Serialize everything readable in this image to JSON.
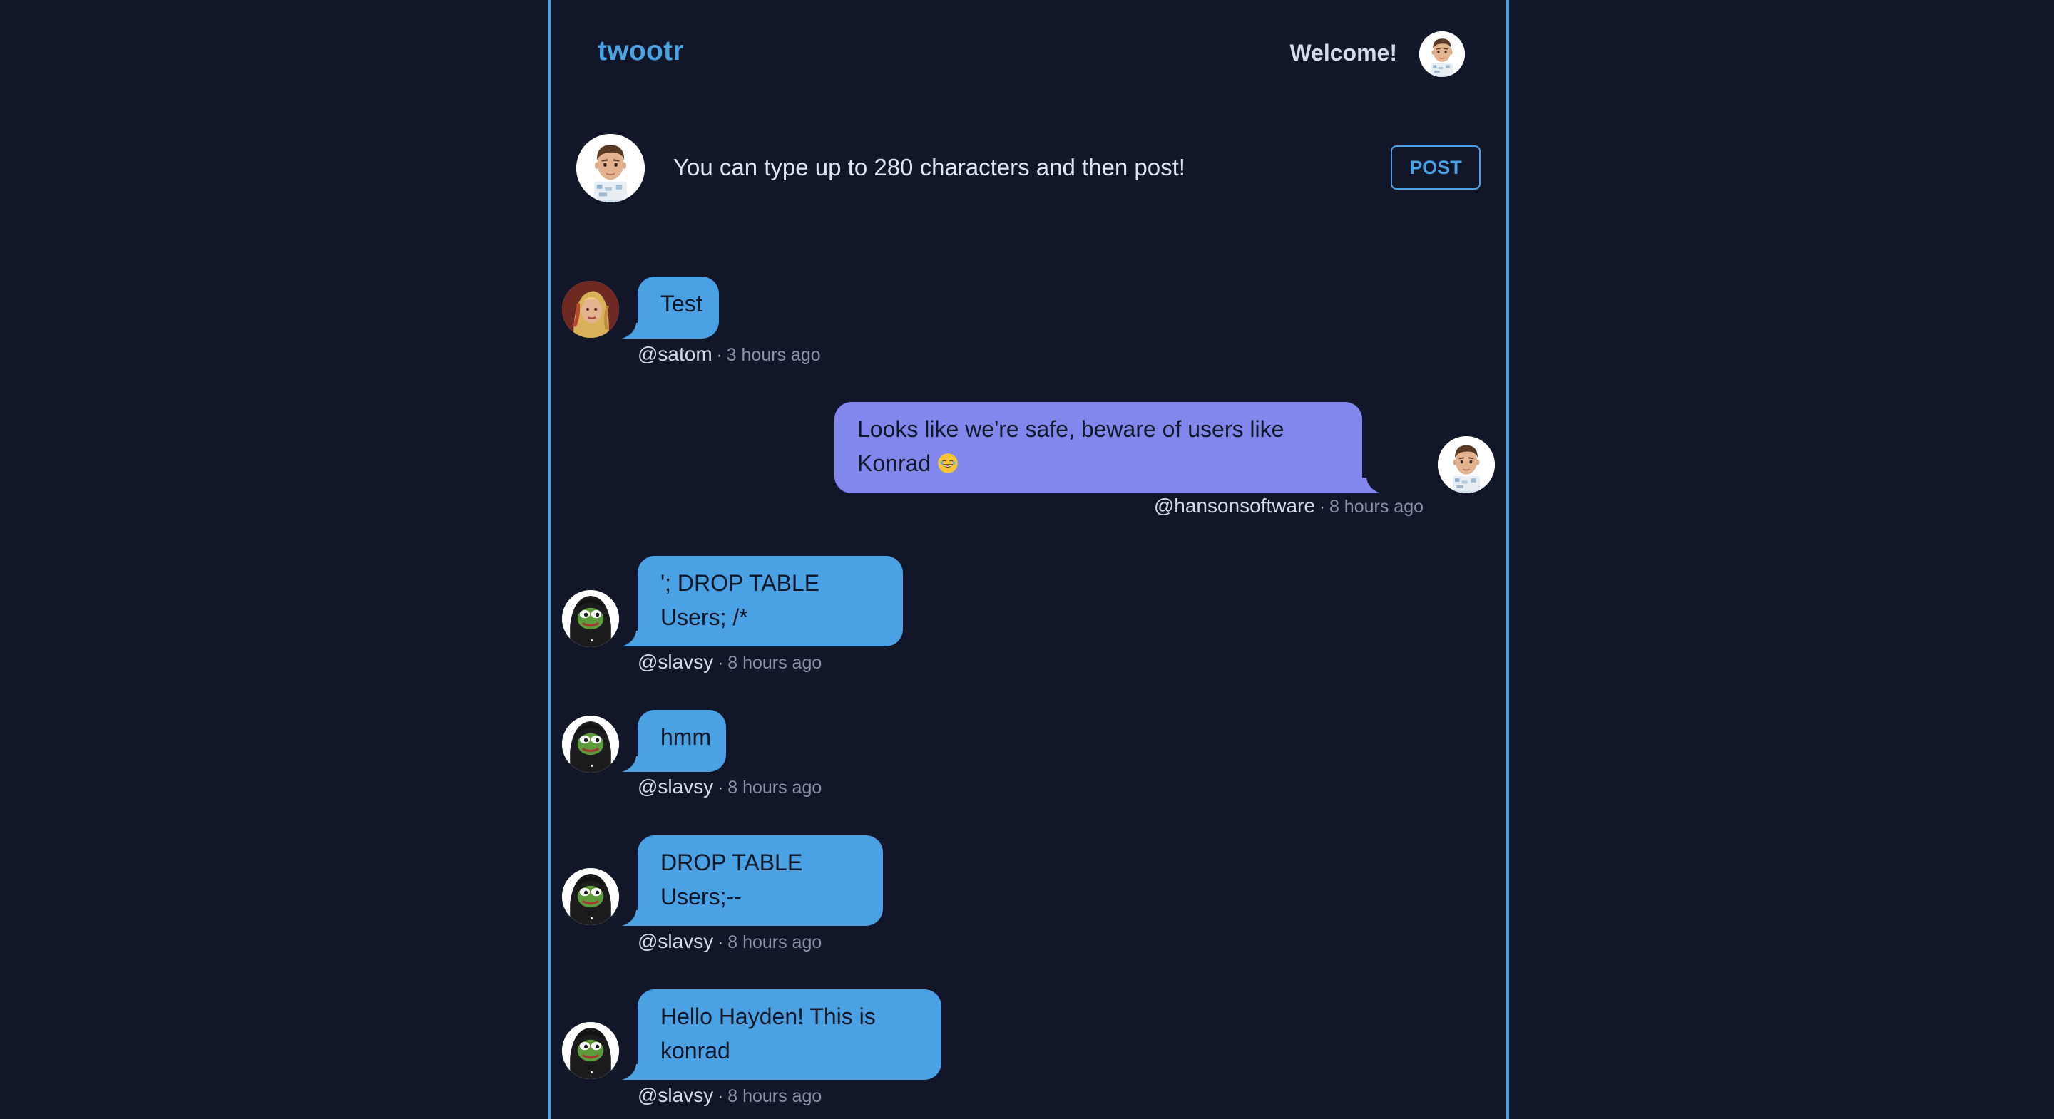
{
  "app": {
    "logo": "twootr",
    "welcome": "Welcome!"
  },
  "composer": {
    "placeholder": "You can type up to 280 characters and then post!",
    "post_label": "POST"
  },
  "colors": {
    "background": "#111729",
    "accent": "#4aa2e5",
    "own_bubble": "#8287ee",
    "other_bubble": "#4aa2e5"
  },
  "feed": [
    {
      "text": "Test",
      "user": "@satom",
      "separator": "·",
      "time": "3 hours ago",
      "avatar": "satom-avatar",
      "own": false
    },
    {
      "text": "Looks like we're safe, beware of users like Konrad",
      "emoji": "laughing-emoji",
      "user": "@hansonsoftware",
      "separator": "·",
      "time": "8 hours ago",
      "avatar": "memoji-avatar",
      "own": true
    },
    {
      "text": "'; DROP TABLE Users; /*",
      "user": "@slavsy",
      "separator": "·",
      "time": "8 hours ago",
      "avatar": "pepe-avatar",
      "own": false
    },
    {
      "text": "hmm",
      "user": "@slavsy",
      "separator": "·",
      "time": "8 hours ago",
      "avatar": "pepe-avatar",
      "own": false
    },
    {
      "text": "DROP TABLE Users;--",
      "user": "@slavsy",
      "separator": "·",
      "time": "8 hours ago",
      "avatar": "pepe-avatar",
      "own": false
    },
    {
      "text": "Hello Hayden! This is konrad",
      "user": "@slavsy",
      "separator": "·",
      "time": "8 hours ago",
      "avatar": "pepe-avatar",
      "own": false
    }
  ]
}
